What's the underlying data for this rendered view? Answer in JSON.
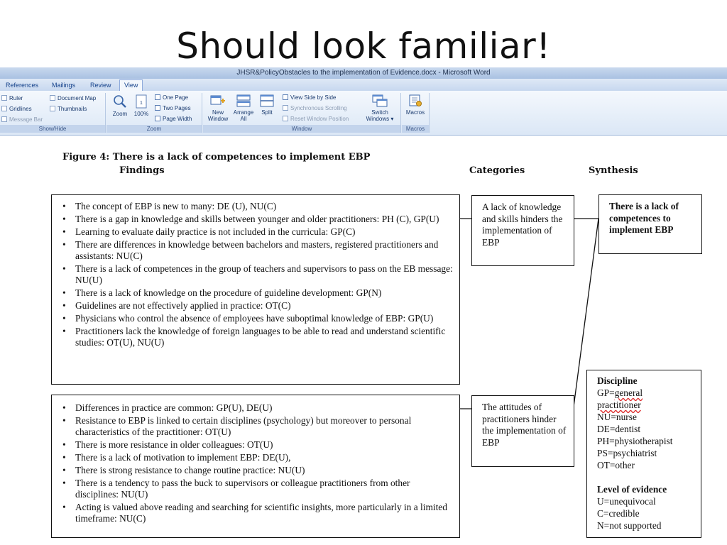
{
  "slide": {
    "title": "Should look familiar!"
  },
  "word": {
    "window_title": "JHSR&PolicyObstacles to the implementation of Evidence.docx - Microsoft Word",
    "tabs": [
      "References",
      "Mailings",
      "Review",
      "View"
    ],
    "active_tab": "View",
    "show_hide": {
      "ruler": "Ruler",
      "gridlines": "Gridlines",
      "message_bar": "Message Bar",
      "document_map": "Document Map",
      "thumbnails": "Thumbnails",
      "label": "Show/Hide"
    },
    "zoom": {
      "zoom": "Zoom",
      "hundred": "100%",
      "one_page": "One Page",
      "two_pages": "Two Pages",
      "page_width": "Page Width",
      "label": "Zoom"
    },
    "window": {
      "new_window": [
        "New",
        "Window"
      ],
      "arrange_all": [
        "Arrange",
        "All"
      ],
      "split": "Split",
      "view_side": "View Side by Side",
      "sync_scroll": "Synchronous Scrolling",
      "reset_pos": "Reset Window Position",
      "switch": [
        "Switch",
        "Windows ▾"
      ],
      "label": "Window"
    },
    "macros": {
      "macros": "Macros",
      "label": "Macros"
    }
  },
  "figure": {
    "title": "Figure 4: There is a lack of competences to implement EBP",
    "headers": {
      "findings": "Findings",
      "categories": "Categories",
      "synthesis": "Synthesis"
    },
    "findings_1": [
      "The concept of EBP is new to many: DE (U), NU(C)",
      "There is a gap in knowledge and skills between younger and older practitioners: PH (C), GP(U)",
      "Learning to evaluate daily practice is not included in the curricula: GP(C)",
      "There are differences in knowledge between bachelors and masters, registered practitioners and assistants: NU(C)",
      "There is a lack of competences in the group of teachers and supervisors to pass on the EB message: NU(U)",
      "There is a lack of knowledge on the procedure of guideline development: GP(N)",
      "Guidelines are not effectively applied in practice: OT(C)",
      "Physicians who control the absence of employees have suboptimal knowledge of EBP: GP(U)",
      "Practitioners lack the knowledge of foreign languages to be able to read and understand scientific studies: OT(U), NU(U)"
    ],
    "findings_2": [
      "Differences in practice are common: GP(U), DE(U)",
      "Resistance to EBP is linked to certain disciplines (psychology) but moreover to personal characteristics of the practitioner: OT(U)",
      "There is more resistance in older colleagues: OT(U)",
      "There is a lack of motivation to implement EBP: DE(U),",
      "There is strong resistance to change routine practice: NU(U)",
      "There is a tendency to pass the buck to supervisors or colleague practitioners from other disciplines: NU(U)",
      "Acting is valued above reading and searching for scientific insights, more particularly in a limited timeframe: NU(C)"
    ],
    "category_1": "A lack of knowledge and skills hinders the implementation of EBP",
    "category_2": "The attitudes of practitioners hinder the implementation of EBP",
    "synthesis": "There is a lack of competences to implement EBP",
    "legend": {
      "discipline_heading": "Discipline",
      "gp_prefix": "GP=",
      "gp_word": "general",
      "gp_line2": "practitioner",
      "nu": "NU=nurse",
      "de": "DE=dentist",
      "ph": "PH=physiotherapist",
      "ps": "PS=psychiatrist",
      "ot": "OT=other",
      "evidence_heading": "Level of evidence",
      "u": "U=unequivocal",
      "c": "C=credible",
      "n": "N=not supported"
    }
  }
}
